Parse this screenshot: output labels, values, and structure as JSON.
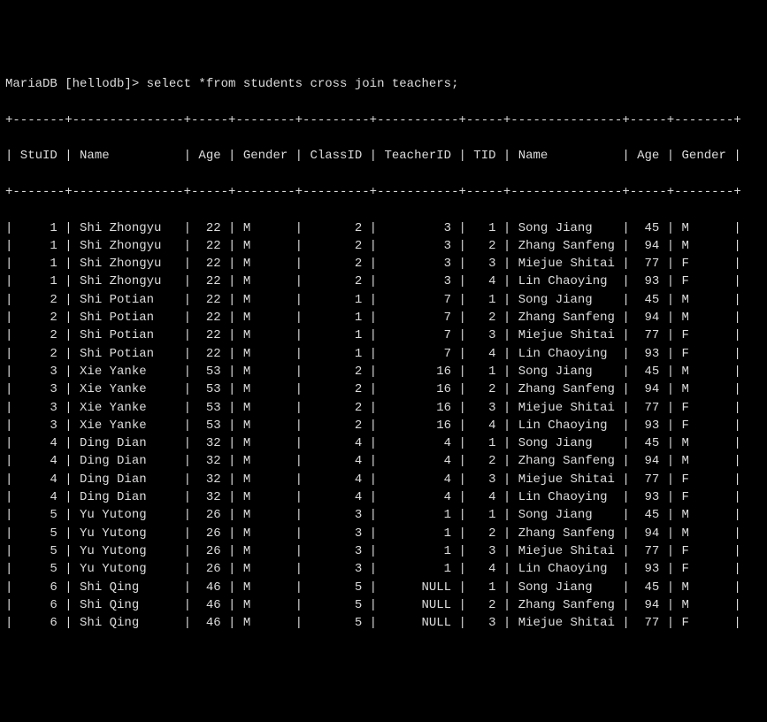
{
  "prompt": "MariaDB [hellodb]> select *from students cross join teachers;",
  "columns": [
    "StuID",
    "Name",
    "Age",
    "Gender",
    "ClassID",
    "TeacherID",
    "TID",
    "Name",
    "Age",
    "Gender"
  ],
  "widths": [
    7,
    15,
    5,
    8,
    9,
    11,
    5,
    15,
    5,
    8
  ],
  "rows": [
    [
      "1",
      "Shi Zhongyu",
      "22",
      "M",
      "2",
      "3",
      "1",
      "Song Jiang",
      "45",
      "M"
    ],
    [
      "1",
      "Shi Zhongyu",
      "22",
      "M",
      "2",
      "3",
      "2",
      "Zhang Sanfeng",
      "94",
      "M"
    ],
    [
      "1",
      "Shi Zhongyu",
      "22",
      "M",
      "2",
      "3",
      "3",
      "Miejue Shitai",
      "77",
      "F"
    ],
    [
      "1",
      "Shi Zhongyu",
      "22",
      "M",
      "2",
      "3",
      "4",
      "Lin Chaoying",
      "93",
      "F"
    ],
    [
      "2",
      "Shi Potian",
      "22",
      "M",
      "1",
      "7",
      "1",
      "Song Jiang",
      "45",
      "M"
    ],
    [
      "2",
      "Shi Potian",
      "22",
      "M",
      "1",
      "7",
      "2",
      "Zhang Sanfeng",
      "94",
      "M"
    ],
    [
      "2",
      "Shi Potian",
      "22",
      "M",
      "1",
      "7",
      "3",
      "Miejue Shitai",
      "77",
      "F"
    ],
    [
      "2",
      "Shi Potian",
      "22",
      "M",
      "1",
      "7",
      "4",
      "Lin Chaoying",
      "93",
      "F"
    ],
    [
      "3",
      "Xie Yanke",
      "53",
      "M",
      "2",
      "16",
      "1",
      "Song Jiang",
      "45",
      "M"
    ],
    [
      "3",
      "Xie Yanke",
      "53",
      "M",
      "2",
      "16",
      "2",
      "Zhang Sanfeng",
      "94",
      "M"
    ],
    [
      "3",
      "Xie Yanke",
      "53",
      "M",
      "2",
      "16",
      "3",
      "Miejue Shitai",
      "77",
      "F"
    ],
    [
      "3",
      "Xie Yanke",
      "53",
      "M",
      "2",
      "16",
      "4",
      "Lin Chaoying",
      "93",
      "F"
    ],
    [
      "4",
      "Ding Dian",
      "32",
      "M",
      "4",
      "4",
      "1",
      "Song Jiang",
      "45",
      "M"
    ],
    [
      "4",
      "Ding Dian",
      "32",
      "M",
      "4",
      "4",
      "2",
      "Zhang Sanfeng",
      "94",
      "M"
    ],
    [
      "4",
      "Ding Dian",
      "32",
      "M",
      "4",
      "4",
      "3",
      "Miejue Shitai",
      "77",
      "F"
    ],
    [
      "4",
      "Ding Dian",
      "32",
      "M",
      "4",
      "4",
      "4",
      "Lin Chaoying",
      "93",
      "F"
    ],
    [
      "5",
      "Yu Yutong",
      "26",
      "M",
      "3",
      "1",
      "1",
      "Song Jiang",
      "45",
      "M"
    ],
    [
      "5",
      "Yu Yutong",
      "26",
      "M",
      "3",
      "1",
      "2",
      "Zhang Sanfeng",
      "94",
      "M"
    ],
    [
      "5",
      "Yu Yutong",
      "26",
      "M",
      "3",
      "1",
      "3",
      "Miejue Shitai",
      "77",
      "F"
    ],
    [
      "5",
      "Yu Yutong",
      "26",
      "M",
      "3",
      "1",
      "4",
      "Lin Chaoying",
      "93",
      "F"
    ],
    [
      "6",
      "Shi Qing",
      "46",
      "M",
      "5",
      "NULL",
      "1",
      "Song Jiang",
      "45",
      "M"
    ],
    [
      "6",
      "Shi Qing",
      "46",
      "M",
      "5",
      "NULL",
      "2",
      "Zhang Sanfeng",
      "94",
      "M"
    ],
    [
      "6",
      "Shi Qing",
      "46",
      "M",
      "5",
      "NULL",
      "3",
      "Miejue Shitai",
      "77",
      "F"
    ]
  ],
  "align": [
    "right",
    "left",
    "right",
    "left",
    "right",
    "right",
    "right",
    "left",
    "right",
    "left"
  ]
}
